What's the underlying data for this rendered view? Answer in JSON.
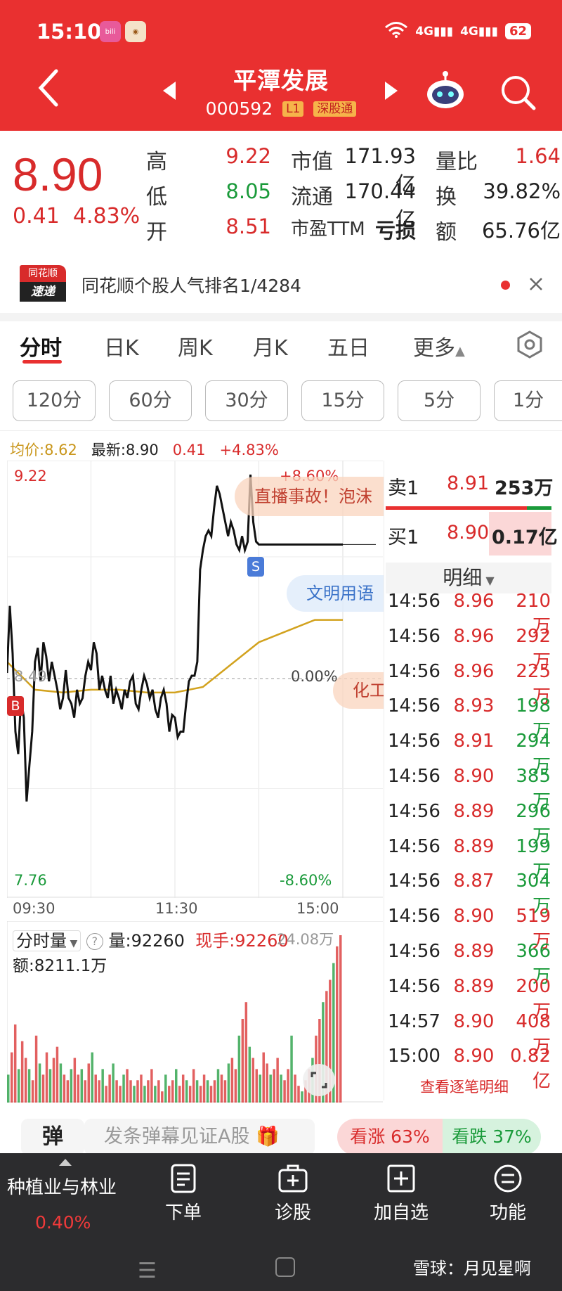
{
  "status_bar": {
    "time": "15:10",
    "signal": "4G",
    "signal2": "4G",
    "battery": "62"
  },
  "header": {
    "title": "平潭发展",
    "code": "000592",
    "tag1": "L1",
    "tag2": "深股通"
  },
  "quote": {
    "price": "8.90",
    "change": "0.41",
    "change_pct": "4.83%",
    "rows": [
      {
        "l1": "高",
        "v1": "9.22",
        "l2": "市值",
        "v2": "171.93亿",
        "l3": "量比",
        "v3": "1.64"
      },
      {
        "l1": "低",
        "v1": "8.05",
        "l2": "流通",
        "v2": "170.44亿",
        "l3": "换",
        "v3": "39.82%"
      },
      {
        "l1": "开",
        "v1": "8.51",
        "l2": "市盈TTM",
        "v2": "亏损",
        "l3": "额",
        "v3": "65.76亿"
      }
    ]
  },
  "banner": {
    "logo_top": "同花顺",
    "logo_bottom": "速递",
    "text": "同花顺个股人气排名1/4284"
  },
  "tabs": [
    "分时",
    "日K",
    "周K",
    "月K",
    "五日",
    "更多"
  ],
  "periods": [
    "120分",
    "60分",
    "30分",
    "15分",
    "5分",
    "1分"
  ],
  "chart_info": {
    "avg_label": "均价:8.62",
    "latest_label": "最新:8.90",
    "chg": "0.41",
    "pct": "+4.83%"
  },
  "chart_labels": {
    "y_top": "9.22",
    "y_mid": "8.49",
    "y_bot": "7.76",
    "pct_top": "+8.60%",
    "pct_mid": "0.00%",
    "pct_bot": "-8.60%",
    "t_start": "09:30",
    "t_mid": "11:30",
    "t_end": "15:00",
    "marker_b": "B",
    "marker_s": "S"
  },
  "overlays": {
    "bubble1": "直播事故！泡沫",
    "bubble2": "文明用语",
    "bubble3": "化工"
  },
  "volume": {
    "title": "分时量",
    "vol": "量:92260",
    "hand": "现手:92260",
    "max": "24.08万",
    "amount": "额:8211.1万"
  },
  "orderbook": {
    "sell_label": "卖1",
    "sell_price": "8.91",
    "sell_vol": "253万",
    "buy_label": "买1",
    "buy_price": "8.90",
    "buy_vol": "0.17亿",
    "detail_label": "明细",
    "rows": [
      {
        "t": "14:56",
        "p": "8.96",
        "v": "210万",
        "c": "red"
      },
      {
        "t": "14:56",
        "p": "8.96",
        "v": "292万",
        "c": "red"
      },
      {
        "t": "14:56",
        "p": "8.96",
        "v": "225万",
        "c": "red"
      },
      {
        "t": "14:56",
        "p": "8.93",
        "v": "198万",
        "c": "green"
      },
      {
        "t": "14:56",
        "p": "8.91",
        "v": "294万",
        "c": "green"
      },
      {
        "t": "14:56",
        "p": "8.90",
        "v": "385万",
        "c": "green"
      },
      {
        "t": "14:56",
        "p": "8.89",
        "v": "296万",
        "c": "green"
      },
      {
        "t": "14:56",
        "p": "8.89",
        "v": "199万",
        "c": "green"
      },
      {
        "t": "14:56",
        "p": "8.87",
        "v": "304万",
        "c": "green"
      },
      {
        "t": "14:56",
        "p": "8.90",
        "v": "519万",
        "c": "red"
      },
      {
        "t": "14:56",
        "p": "8.89",
        "v": "366万",
        "c": "green"
      },
      {
        "t": "14:56",
        "p": "8.89",
        "v": "200万",
        "c": "red"
      },
      {
        "t": "14:57",
        "p": "8.90",
        "v": "408万",
        "c": "red"
      },
      {
        "t": "15:00",
        "p": "8.90",
        "v": "0.82亿",
        "c": "red"
      }
    ],
    "more_link": "查看逐笔明细"
  },
  "bullet": {
    "icon": "弹",
    "placeholder": "发条弹幕见证A股",
    "up": "看涨 63%",
    "down": "看跌 37%",
    "up_pct": 63
  },
  "bottom_nav": {
    "sector_name": "种植业与林业",
    "sector_pct": "0.40%",
    "items": [
      "下单",
      "诊股",
      "加自选",
      "功能"
    ]
  },
  "watermark": "雪球：月见星啊",
  "colors": {
    "red": "#e93030",
    "up": "#d82b2b",
    "down": "#1a9a3a",
    "avg_line": "#d2a21e"
  },
  "chart_data": {
    "type": "line",
    "x_ticks": [
      "09:30",
      "11:30",
      "15:00"
    ],
    "ylim": [
      7.76,
      9.22
    ],
    "pre_close": 8.49,
    "series": [
      {
        "x": [
          0,
          2,
          4,
          6,
          8,
          10,
          12,
          14,
          16,
          18,
          20,
          22,
          24,
          26,
          28,
          30,
          32,
          34,
          36,
          38,
          40,
          42,
          44,
          46,
          48,
          50,
          52,
          54,
          56,
          58,
          60,
          62,
          64,
          66,
          68,
          70,
          72,
          74,
          76,
          78,
          80,
          82,
          84,
          86,
          88,
          90,
          92,
          94,
          96,
          98,
          100,
          102,
          104,
          106,
          108,
          110,
          112,
          114,
          116,
          118,
          120,
          122,
          124,
          126,
          128,
          130,
          132,
          134,
          136,
          138,
          140,
          142,
          144,
          146,
          148,
          150,
          152,
          154,
          156,
          158,
          160,
          162,
          164,
          166,
          168,
          170,
          172,
          174,
          176,
          178,
          180,
          182,
          184,
          186,
          188,
          190,
          192,
          194,
          196,
          198,
          200,
          202,
          204,
          206,
          208,
          210,
          212,
          214,
          216,
          218,
          220,
          222,
          224,
          226,
          228,
          230,
          232,
          234,
          236,
          238,
          240
        ],
        "values": [
          8.51,
          8.75,
          8.58,
          8.3,
          8.22,
          8.42,
          8.35,
          8.05,
          8.18,
          8.3,
          8.55,
          8.6,
          8.48,
          8.62,
          8.57,
          8.48,
          8.55,
          8.5,
          8.45,
          8.38,
          8.42,
          8.52,
          8.42,
          8.4,
          8.35,
          8.45,
          8.4,
          8.42,
          8.5,
          8.55,
          8.52,
          8.62,
          8.58,
          8.45,
          8.5,
          8.45,
          8.42,
          8.5,
          8.4,
          8.45,
          8.42,
          8.38,
          8.45,
          8.42,
          8.48,
          8.5,
          8.4,
          8.38,
          8.45,
          8.5,
          8.47,
          8.42,
          8.45,
          8.38,
          8.35,
          8.42,
          8.45,
          8.4,
          8.3,
          8.36,
          8.35,
          8.28,
          8.3,
          8.3,
          8.4,
          8.48,
          8.5,
          8.5,
          8.55,
          8.88,
          8.95,
          9.0,
          9.02,
          9.0,
          9.1,
          9.18,
          9.15,
          9.1,
          9.05,
          9.0,
          9.05,
          9.02,
          8.97,
          8.95,
          9.0,
          8.95,
          8.98,
          9.22,
          9.05,
          8.98,
          8.97,
          8.97,
          8.97,
          8.97,
          8.97,
          8.97,
          8.97,
          8.97,
          8.97,
          8.97,
          8.97,
          8.97,
          8.97,
          8.97,
          8.97,
          8.97,
          8.97,
          8.97,
          8.97,
          8.97,
          8.97,
          8.97,
          8.97,
          8.97,
          8.97,
          8.97,
          8.97,
          8.97,
          8.97,
          8.97,
          8.97
        ]
      },
      {
        "x": [
          0,
          20,
          40,
          60,
          80,
          100,
          120,
          140,
          160,
          180,
          200,
          220,
          240
        ],
        "values": [
          8.55,
          8.45,
          8.44,
          8.45,
          8.45,
          8.44,
          8.44,
          8.46,
          8.54,
          8.62,
          8.66,
          8.7,
          8.7
        ]
      }
    ],
    "volume": [
      5,
      9,
      14,
      6,
      11,
      8,
      6,
      4,
      12,
      7,
      5,
      9,
      6,
      8,
      10,
      7,
      5,
      4,
      6,
      8,
      5,
      6,
      4,
      7,
      9,
      5,
      4,
      6,
      3,
      5,
      7,
      4,
      3,
      5,
      6,
      4,
      3,
      4,
      5,
      3,
      4,
      6,
      3,
      4,
      2,
      5,
      3,
      4,
      6,
      3,
      5,
      4,
      3,
      6,
      4,
      3,
      5,
      4,
      3,
      4,
      6,
      5,
      4,
      7,
      8,
      6,
      12,
      15,
      18,
      10,
      8,
      6,
      5,
      9,
      7,
      5,
      6,
      8,
      5,
      4,
      6,
      12,
      5,
      3,
      2,
      4,
      6,
      8,
      12,
      15,
      18,
      20,
      22,
      25,
      28,
      30
    ]
  }
}
